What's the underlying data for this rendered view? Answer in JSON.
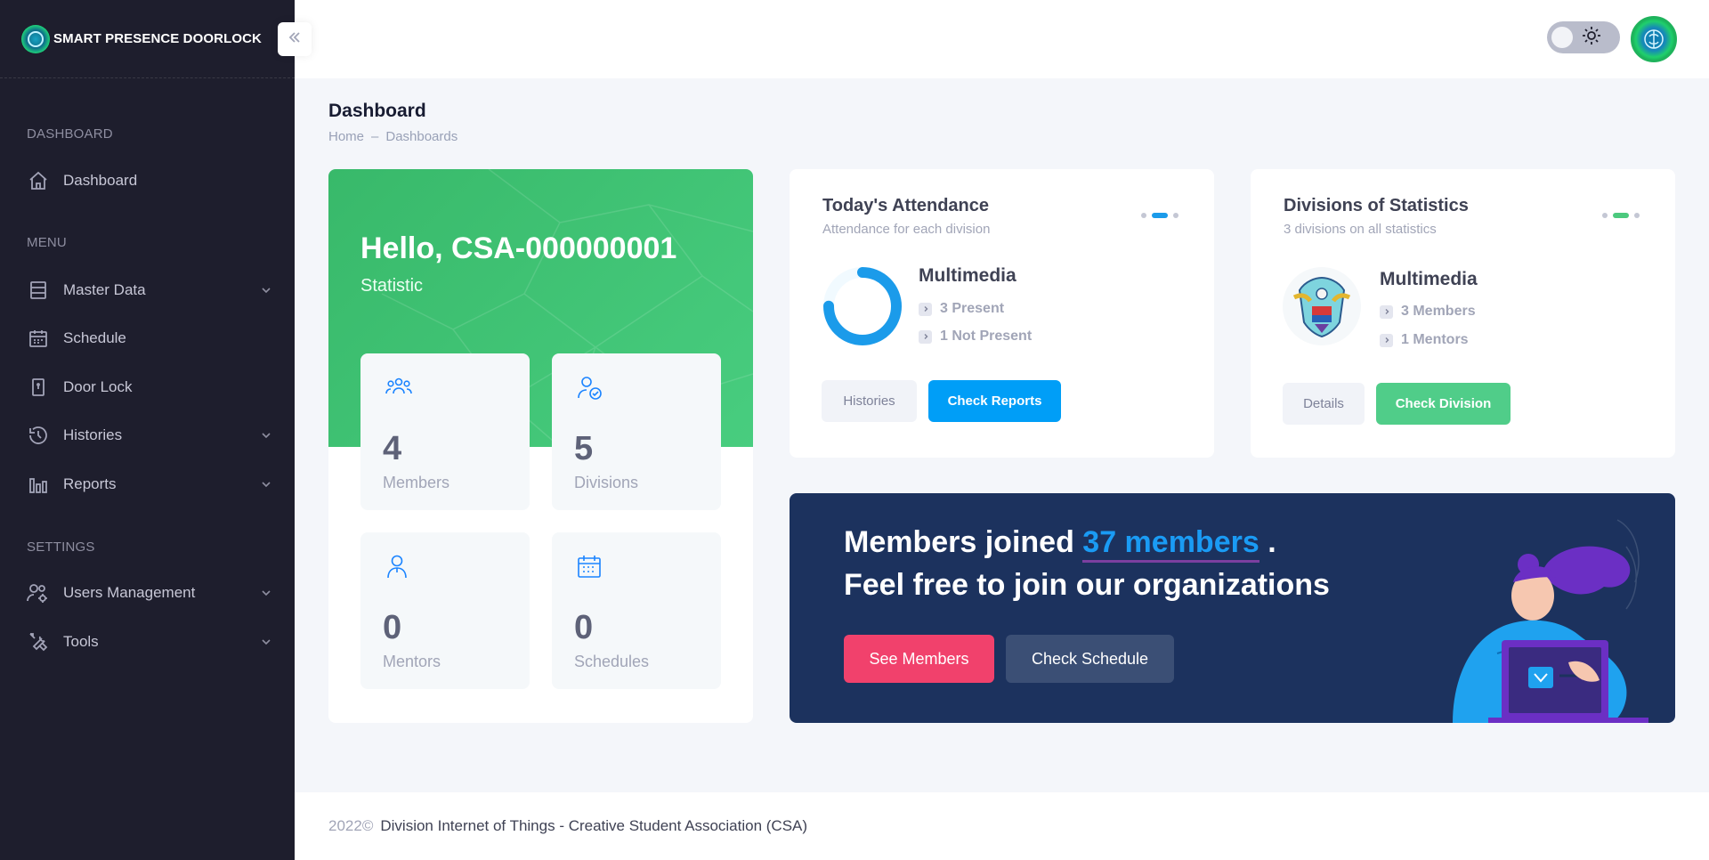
{
  "brand": {
    "name": "SMART PRESENCE DOORLOCK"
  },
  "sidebar": {
    "sections": {
      "dashboard": "DASHBOARD",
      "menu": "MENU",
      "settings": "SETTINGS"
    },
    "items": [
      {
        "label": "Dashboard",
        "icon": "home-icon"
      },
      {
        "label": "Master Data",
        "icon": "database-icon",
        "expandable": true
      },
      {
        "label": "Schedule",
        "icon": "calendar-icon"
      },
      {
        "label": "Door Lock",
        "icon": "door-icon"
      },
      {
        "label": "Histories",
        "icon": "history-icon",
        "expandable": true
      },
      {
        "label": "Reports",
        "icon": "bar-chart-icon",
        "expandable": true
      },
      {
        "label": "Users Management",
        "icon": "users-gear-icon",
        "expandable": true
      },
      {
        "label": "Tools",
        "icon": "tools-icon",
        "expandable": true
      }
    ]
  },
  "header": {
    "title": "Dashboard",
    "breadcrumb": {
      "home": "Home",
      "separator": "–",
      "current": "Dashboards"
    }
  },
  "welcome": {
    "greeting": "Hello, CSA-000000001",
    "subtitle": "Statistic",
    "stats": [
      {
        "value": "4",
        "label": "Members",
        "icon": "group-icon"
      },
      {
        "value": "5",
        "label": "Divisions",
        "icon": "user-check-icon"
      },
      {
        "value": "0",
        "label": "Mentors",
        "icon": "user-icon"
      },
      {
        "value": "0",
        "label": "Schedules",
        "icon": "calendar-icon"
      }
    ]
  },
  "attendance": {
    "title": "Today's Attendance",
    "subtitle": "Attendance for each division",
    "division": "Multimedia",
    "present": "3 Present",
    "not_present": "1 Not Present",
    "progress": 0.75,
    "btn_histories": "Histories",
    "btn_reports": "Check Reports"
  },
  "divisions": {
    "title": "Divisions of Statistics",
    "subtitle": "3 divisions on all statistics",
    "division": "Multimedia",
    "members": "3 Members",
    "mentors": "1 Mentors",
    "btn_details": "Details",
    "btn_check": "Check Division"
  },
  "promo": {
    "line1_prefix": "Members joined",
    "highlight": "37 members",
    "line1_suffix": ".",
    "line2": "Feel free to join our organizations",
    "btn_members": "See Members",
    "btn_schedule": "Check Schedule"
  },
  "footer": {
    "year": "2022©",
    "text": "Division Internet of Things - Creative Student Association (CSA)"
  },
  "colors": {
    "sidebar": "#1e1e2d",
    "green": "#50cd89",
    "blue": "#009ef7",
    "pink": "#f1416c",
    "navy": "#1c325e"
  }
}
